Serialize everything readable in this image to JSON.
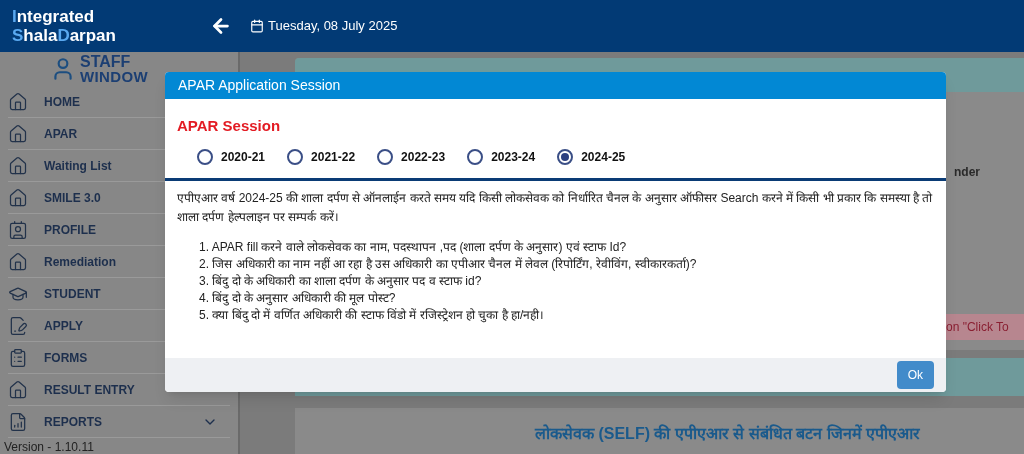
{
  "header": {
    "logo": [
      [
        {
          "text": "I",
          "accent": true
        },
        {
          "text": "ntegrated",
          "accent": false
        }
      ],
      [
        {
          "text": "S",
          "accent": true
        },
        {
          "text": "hala",
          "accent": false
        },
        {
          "text": "D",
          "accent": true
        },
        {
          "text": "arpan",
          "accent": false
        }
      ]
    ],
    "date": "Tuesday, 08 July 2025"
  },
  "sidebar": {
    "brand": [
      "STAFF",
      "WINDOW"
    ],
    "items": [
      {
        "label": "HOME",
        "kind": "home"
      },
      {
        "label": "APAR",
        "kind": "home"
      },
      {
        "label": "Waiting List",
        "kind": "home"
      },
      {
        "label": "SMILE 3.0",
        "kind": "home"
      },
      {
        "label": "PROFILE",
        "kind": "profile"
      },
      {
        "label": "Remediation",
        "kind": "home"
      },
      {
        "label": "STUDENT",
        "kind": "student"
      },
      {
        "label": "APPLY",
        "kind": "apply"
      },
      {
        "label": "FORMS",
        "kind": "forms"
      },
      {
        "label": "RESULT ENTRY",
        "kind": "home"
      },
      {
        "label": "REPORTS",
        "kind": "reports"
      }
    ],
    "version": "Version - 1.10.11"
  },
  "background": {
    "column_header": "nder",
    "alert": "on \"Click To",
    "heading": "लोकसेवक (SELF) की एपीएआर से संबंधित बटन जिनमें एपीएआर"
  },
  "modal": {
    "title": "APAR Application Session",
    "section_title": "APAR Session",
    "sessions": [
      {
        "label": "2020-21",
        "selected": false
      },
      {
        "label": "2021-22",
        "selected": false
      },
      {
        "label": "2022-23",
        "selected": false
      },
      {
        "label": "2023-24",
        "selected": false
      },
      {
        "label": "2024-25",
        "selected": true
      }
    ],
    "intro": "एपीएआर वर्ष 2024-25 की शाला दर्पण से ऑनलाईन करते समय यदि किसी लोकसेवक को निर्धारित चैनल के अनुसार ऑफीसर Search करने में किसी भी प्रकार कि समस्या है तो शाला दर्पण हेल्पलाइन पर सम्पर्क करें।",
    "points": [
      "1. APAR fill करने वाले लोकसेवक का नाम, पदस्थापन ,पद (शाला दर्पण के अनुसार) एवं स्टाफ Id?",
      "2. जिस अधिकारी का नाम नहीं आ रहा है उस अधिकारी का एपीआर चैनल में लेवल (रिपोर्टिंग, रेवीविंग, स्वीकारकर्ता)?",
      "3. बिंदु दो के अधिकारी का शाला दर्पण के अनुसार पद व स्टाफ id?",
      "4. बिंदु दो के अनुसार अधिकारी की मूल पोस्ट?",
      "5. क्या बिंदु दो में वर्णित अधिकारी की स्टाफ विंडो में रजिस्ट्रेशन हो चुका है हा/नही।"
    ],
    "ok_button": "Ok"
  }
}
